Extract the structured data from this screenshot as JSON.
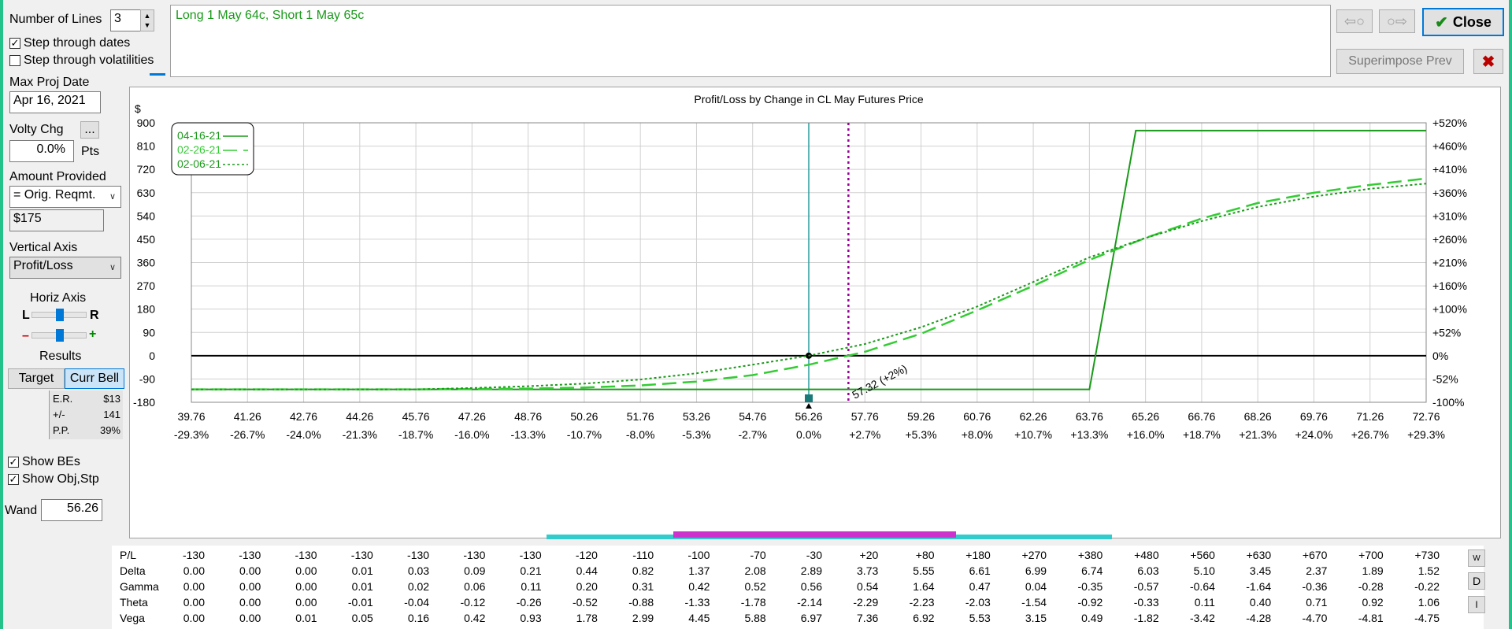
{
  "controls": {
    "number_of_lines_label": "Number of Lines",
    "number_of_lines_value": "3",
    "step_dates_label": "Step through dates",
    "step_dates_checked": true,
    "step_vols_label": "Step through volatilities",
    "step_vols_checked": false,
    "max_proj_date_label": "Max Proj Date",
    "max_proj_date_value": "Apr 16, 2021",
    "volty_chg_label": "Volty Chg",
    "volty_chg_value": "0.0%",
    "volty_chg_unit": "Pts",
    "volty_more_button": "...",
    "amount_provided_label": "Amount Provided",
    "amount_provided_select": "= Orig. Reqmt.",
    "amount_value": "$175",
    "vertical_axis_label": "Vertical Axis",
    "vertical_axis_select": "Profit/Loss",
    "horiz_axis_label": "Horiz Axis",
    "horiz_left": "L",
    "horiz_right": "R",
    "zoom_minus": "–",
    "zoom_plus": "+",
    "results_label": "Results",
    "target_button": "Target",
    "curr_bell_button": "Curr Bell",
    "results": [
      {
        "k": "E.R.",
        "v": "$13"
      },
      {
        "k": "+/-",
        "v": "141"
      },
      {
        "k": "P.P.",
        "v": "39%"
      }
    ],
    "show_bes_label": "Show BEs",
    "show_bes_checked": true,
    "show_objstp_label": "Show Obj,Stp",
    "show_objstp_checked": true,
    "wand_label": "Wand",
    "wand_value": "56.26"
  },
  "position_text": "Long 1 May 64c, Short 1 May 65c",
  "buttons": {
    "prev_arrow": "⇦○",
    "next_arrow": "○⇨",
    "close": "Close",
    "superimpose": "Superimpose Prev",
    "x_close": "✖"
  },
  "colors": {
    "series_green": "#1a9a1a",
    "series_light_green": "#33cc33",
    "price_line": "#2a9d9d",
    "target_line": "#990099",
    "zero_line": "#000000",
    "bar_cyan": "#33cccc",
    "bar_magenta": "#cc33cc",
    "close_border": "#0078d7"
  },
  "chart_data": {
    "type": "line",
    "title": "Profit/Loss by Change in CL May Futures Price",
    "ylabel": "$",
    "ylim": [
      -180,
      900
    ],
    "y_ticks": [
      900,
      810,
      720,
      630,
      540,
      450,
      360,
      270,
      180,
      90,
      0,
      -90,
      -180
    ],
    "y_tick_labels": [
      "900",
      "810",
      "720",
      "630",
      "540",
      "450",
      "360",
      "270",
      "180",
      "90",
      "0",
      "-90",
      "-180"
    ],
    "y2_tick_labels": [
      "+520%",
      "+460%",
      "+410%",
      "+360%",
      "+310%",
      "+260%",
      "+210%",
      "+160%",
      "+100%",
      "+52%",
      "0%",
      "-52%",
      "-100%"
    ],
    "xlim": [
      39.76,
      72.76
    ],
    "x_ticks": [
      39.76,
      41.26,
      42.76,
      44.26,
      45.76,
      47.26,
      48.76,
      50.26,
      51.76,
      53.26,
      54.76,
      56.26,
      57.76,
      59.26,
      60.76,
      62.26,
      63.76,
      65.26,
      66.76,
      68.26,
      69.76,
      71.26,
      72.76
    ],
    "x_tick_labels": [
      "39.76",
      "41.26",
      "42.76",
      "44.26",
      "45.76",
      "47.26",
      "48.76",
      "50.26",
      "51.76",
      "53.26",
      "54.76",
      "56.26",
      "57.76",
      "59.26",
      "60.76",
      "62.26",
      "63.76",
      "65.26",
      "66.76",
      "68.26",
      "69.76",
      "71.26",
      "72.76"
    ],
    "x2_tick_labels": [
      "-29.3%",
      "-26.7%",
      "-24.0%",
      "-21.3%",
      "-18.7%",
      "-16.0%",
      "-13.3%",
      "-10.7%",
      "-8.0%",
      "-5.3%",
      "-2.7%",
      "0.0%",
      "+2.7%",
      "+5.3%",
      "+8.0%",
      "+10.7%",
      "+13.3%",
      "+16.0%",
      "+18.7%",
      "+21.3%",
      "+24.0%",
      "+26.7%",
      "+29.3%"
    ],
    "current_price": 56.26,
    "target_price": 57.32,
    "target_label": "57.32 (+2%)",
    "legend_placement": "top-left",
    "series": [
      {
        "name": "04-16-21",
        "style": "solid",
        "x": [
          39.76,
          63.76,
          65.0,
          72.76
        ],
        "y": [
          -130,
          -130,
          870,
          870
        ]
      },
      {
        "name": "02-26-21",
        "style": "dashed",
        "x": [
          39.76,
          45.76,
          48.76,
          50.26,
          51.76,
          53.26,
          54.76,
          56.26,
          57.76,
          59.26,
          60.76,
          62.26,
          63.76,
          65.26,
          66.76,
          68.26,
          69.76,
          71.26,
          72.76
        ],
        "y": [
          -130,
          -130,
          -127,
          -123,
          -115,
          -100,
          -75,
          -35,
          15,
          85,
          175,
          270,
          370,
          455,
          530,
          590,
          630,
          660,
          685
        ]
      },
      {
        "name": "02-06-21",
        "style": "dotted",
        "x": [
          39.76,
          45.76,
          47.26,
          48.76,
          50.26,
          51.76,
          53.26,
          54.76,
          56.26,
          57.76,
          59.26,
          60.76,
          62.26,
          63.76,
          65.26,
          66.76,
          68.26,
          69.76,
          71.26,
          72.76
        ],
        "y": [
          -130,
          -130,
          -125,
          -118,
          -108,
          -92,
          -68,
          -35,
          0,
          45,
          110,
          190,
          285,
          380,
          455,
          520,
          575,
          615,
          645,
          665
        ]
      }
    ],
    "legend_suffixes": [
      "——",
      "*—·",
      "-----"
    ]
  },
  "greeks": {
    "rows": [
      {
        "name": "P/L",
        "values": [
          "-130",
          "-130",
          "-130",
          "-130",
          "-130",
          "-130",
          "-130",
          "-120",
          "-110",
          "-100",
          "-70",
          "-30",
          "+20",
          "+80",
          "+180",
          "+270",
          "+380",
          "+480",
          "+560",
          "+630",
          "+670",
          "+700",
          "+730"
        ]
      },
      {
        "name": "Delta",
        "values": [
          "0.00",
          "0.00",
          "0.00",
          "0.01",
          "0.03",
          "0.09",
          "0.21",
          "0.44",
          "0.82",
          "1.37",
          "2.08",
          "2.89",
          "3.73",
          "5.55",
          "6.61",
          "6.99",
          "6.74",
          "6.03",
          "5.10",
          "3.45",
          "2.37",
          "1.89",
          "1.52"
        ]
      },
      {
        "name": "Gamma",
        "values": [
          "0.00",
          "0.00",
          "0.00",
          "0.01",
          "0.02",
          "0.06",
          "0.11",
          "0.20",
          "0.31",
          "0.42",
          "0.52",
          "0.56",
          "0.54",
          "1.64",
          "0.47",
          "0.04",
          "-0.35",
          "-0.57",
          "-0.64",
          "-1.64",
          "-0.36",
          "-0.28",
          "-0.22"
        ]
      },
      {
        "name": "Theta",
        "values": [
          "0.00",
          "0.00",
          "0.00",
          "-0.01",
          "-0.04",
          "-0.12",
          "-0.26",
          "-0.52",
          "-0.88",
          "-1.33",
          "-1.78",
          "-2.14",
          "-2.29",
          "-2.23",
          "-2.03",
          "-1.54",
          "-0.92",
          "-0.33",
          "0.11",
          "0.40",
          "0.71",
          "0.92",
          "1.06"
        ]
      },
      {
        "name": "Vega",
        "values": [
          "0.00",
          "0.00",
          "0.01",
          "0.05",
          "0.16",
          "0.42",
          "0.93",
          "1.78",
          "2.99",
          "4.45",
          "5.88",
          "6.97",
          "7.36",
          "6.92",
          "5.53",
          "3.15",
          "0.49",
          "-1.82",
          "-3.42",
          "-4.28",
          "-4.70",
          "-4.81",
          "-4.75"
        ]
      }
    ],
    "side_buttons": [
      "W",
      "D",
      "I"
    ]
  }
}
